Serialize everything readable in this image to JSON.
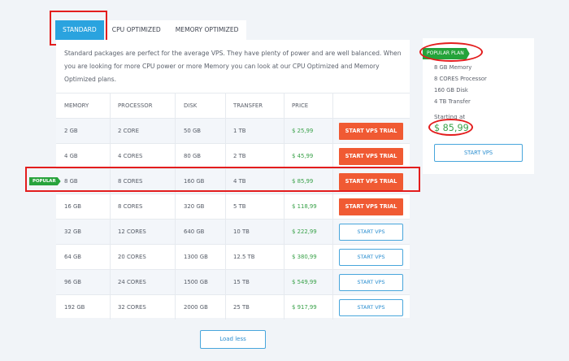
{
  "tabs": [
    "STANDARD",
    "CPU OPTIMIZED",
    "MEMORY OPTIMIZED"
  ],
  "description": "Standard packages are perfect for the average VPS. They have plenty of power and are well balanced. When you are looking for more CPU power or more Memory you can look at our CPU Optimized and Memory Optimized plans.",
  "table": {
    "headers": [
      "MEMORY",
      "PROCESSOR",
      "DISK",
      "TRANSFER",
      "PRICE"
    ],
    "rows": [
      {
        "memory": "2 GB",
        "processor": "2 CORE",
        "disk": "50 GB",
        "transfer": "1 TB",
        "price": "$ 25,99",
        "button": "START VPS TRIAL"
      },
      {
        "memory": "4 GB",
        "processor": "4 CORES",
        "disk": "80 GB",
        "transfer": "2 TB",
        "price": "$ 45,99",
        "button": "START VPS TRIAL"
      },
      {
        "memory": "8 GB",
        "processor": "8 CORES",
        "disk": "160 GB",
        "transfer": "4 TB",
        "price": "$ 85,99",
        "button": "START VPS TRIAL",
        "badge": "POPULAR"
      },
      {
        "memory": "16 GB",
        "processor": "8 CORES",
        "disk": "320 GB",
        "transfer": "5 TB",
        "price": "$ 118,99",
        "button": "START VPS TRIAL"
      },
      {
        "memory": "32 GB",
        "processor": "12 CORES",
        "disk": "640 GB",
        "transfer": "10 TB",
        "price": "$ 222,99",
        "button": "START VPS"
      },
      {
        "memory": "64 GB",
        "processor": "20 CORES",
        "disk": "1300 GB",
        "transfer": "12.5 TB",
        "price": "$ 380,99",
        "button": "START VPS"
      },
      {
        "memory": "96 GB",
        "processor": "24 CORES",
        "disk": "1500 GB",
        "transfer": "15 TB",
        "price": "$ 549,99",
        "button": "START VPS"
      },
      {
        "memory": "192 GB",
        "processor": "32 CORES",
        "disk": "2000 GB",
        "transfer": "25 TB",
        "price": "$ 917,99",
        "button": "START VPS"
      }
    ]
  },
  "popular_plan": {
    "label": "POPULAR PLAN",
    "specs": [
      "8 GB Memory",
      "8 CORES Processor",
      "160 GB Disk",
      "4 TB Transfer"
    ],
    "starting_label": "Starting at",
    "price": "$ 85,99",
    "button": "START VPS"
  },
  "load_less": "Load less",
  "colors": {
    "accent": "#2aa3df",
    "trial_button": "#f05a33",
    "price": "#3aa24a",
    "badge": "#28a33c",
    "highlight": "#e31d1d"
  }
}
